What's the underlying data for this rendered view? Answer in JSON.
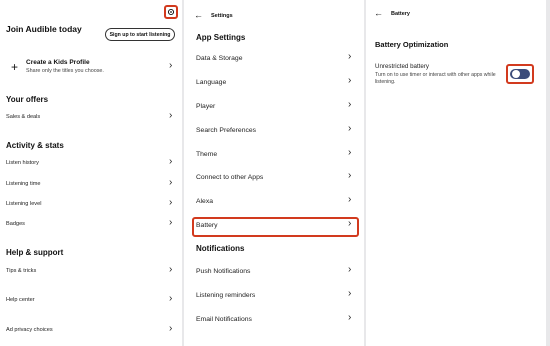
{
  "profile": {
    "join_title": "Join Audible today",
    "signup_button": "Sign up to start listening",
    "kids_profile_title": "Create a Kids Profile",
    "kids_profile_subtitle": "Share only the titles you choose.",
    "sections": [
      {
        "title": "Your offers",
        "items": [
          "Sales & deals"
        ]
      },
      {
        "title": "Activity & stats",
        "items": [
          "Listen history",
          "Listening time",
          "Listening level",
          "Badges"
        ]
      },
      {
        "title": "Help & support",
        "items": [
          "Tips & tricks",
          "Help center",
          "Ad privacy choices"
        ]
      }
    ]
  },
  "settings": {
    "header_title": "Settings",
    "app_settings_title": "App Settings",
    "items": [
      "Data & Storage",
      "Language",
      "Player",
      "Search Preferences",
      "Theme",
      "Connect to other Apps",
      "Alexa",
      "Battery"
    ],
    "notifications_title": "Notifications",
    "notification_items": [
      "Push Notifications",
      "Listening reminders",
      "Email Notifications"
    ]
  },
  "battery": {
    "header_title": "Battery",
    "section_title": "Battery Optimization",
    "setting_title": "Unrestricted battery",
    "setting_description": "Turn on to use timer or interact with other apps while listening."
  },
  "colors": {
    "highlight": "#d23a1e",
    "toggle_track": "#3c4c7a"
  },
  "icons": [
    "gear-icon",
    "plus-icon",
    "chevron-right-icon",
    "back-arrow-icon"
  ],
  "toggle_state": "off"
}
